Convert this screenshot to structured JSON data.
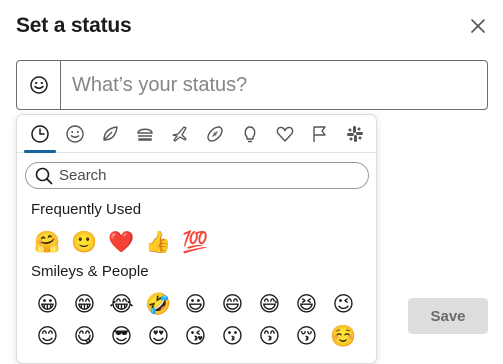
{
  "dialog": {
    "title": "Set a status",
    "close_icon": "close-icon"
  },
  "status": {
    "placeholder": "What’s your status?",
    "value": "",
    "emoji_button_icon": "smiley-outline-icon"
  },
  "picker": {
    "tabs": [
      {
        "icon": "clock-icon",
        "name": "Frequently Used",
        "active": true
      },
      {
        "icon": "smiley-icon",
        "name": "Smileys & People"
      },
      {
        "icon": "leaf-icon",
        "name": "Nature"
      },
      {
        "icon": "burger-icon",
        "name": "Food & Drink"
      },
      {
        "icon": "plane-icon",
        "name": "Travel & Places"
      },
      {
        "icon": "football-icon",
        "name": "Activities"
      },
      {
        "icon": "lightbulb-icon",
        "name": "Objects"
      },
      {
        "icon": "heart-icon",
        "name": "Symbols"
      },
      {
        "icon": "flag-icon",
        "name": "Flags"
      },
      {
        "icon": "slack-icon",
        "name": "Custom"
      }
    ],
    "accent_color": "#1264a3",
    "search_placeholder": "Search",
    "sections": {
      "frequently_used": {
        "title": "Frequently Used",
        "emojis": [
          "🤗",
          "🙂",
          "❤️",
          "👍",
          "💯"
        ]
      },
      "smileys_people": {
        "title": "Smileys & People",
        "rows": [
          [
            "😀",
            "😁",
            "😂",
            "🤣",
            "😃",
            "😄",
            "😅",
            "😆",
            "😉"
          ],
          [
            "😊",
            "😋",
            "😎",
            "😍",
            "😘",
            "😗",
            "😙",
            "😚",
            "☺️"
          ]
        ]
      }
    }
  },
  "actions": {
    "save_label": "Save",
    "save_color": "#dddddd"
  }
}
